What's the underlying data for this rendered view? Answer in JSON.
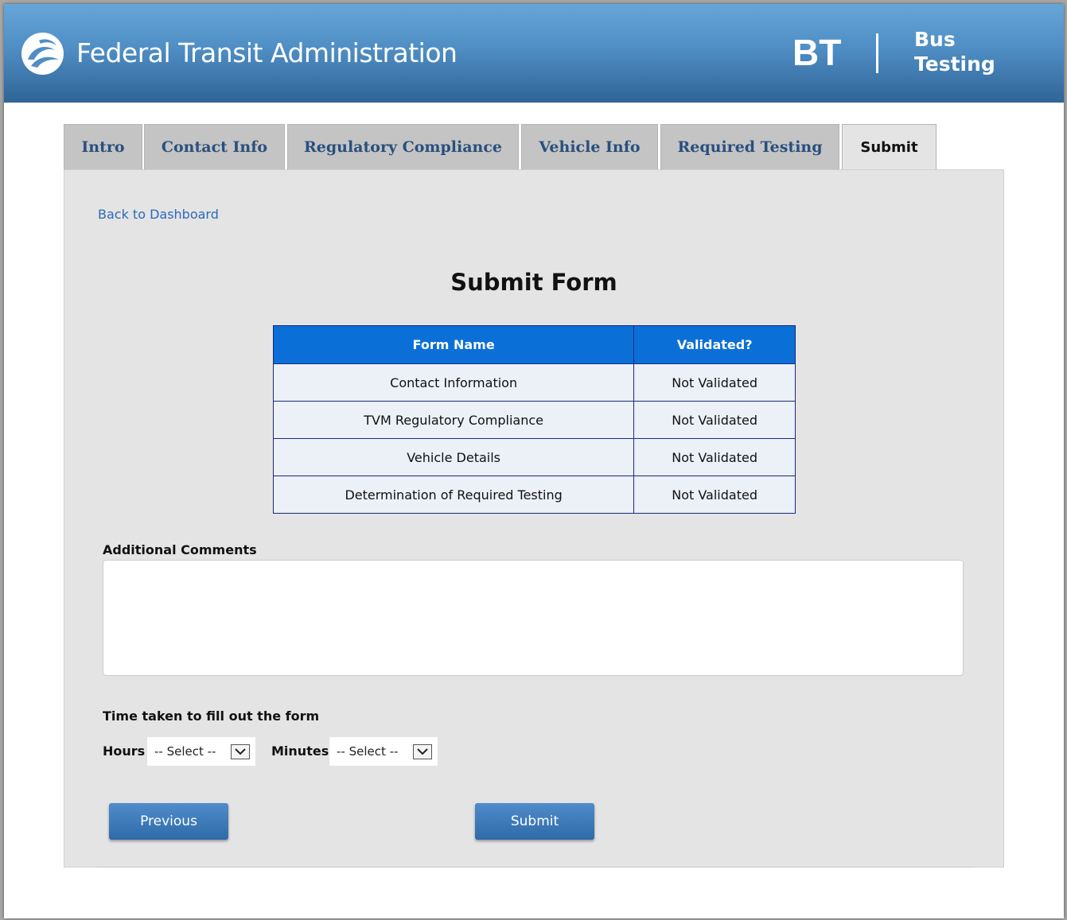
{
  "header": {
    "agency_name": "Federal Transit Administration",
    "app_abbr": "BT",
    "app_name_line1": "Bus",
    "app_name_line2": "Testing"
  },
  "tabs": [
    {
      "label": "Intro",
      "active": false
    },
    {
      "label": "Contact Info",
      "active": false
    },
    {
      "label": "Regulatory Compliance",
      "active": false
    },
    {
      "label": "Vehicle Info",
      "active": false
    },
    {
      "label": "Required Testing",
      "active": false
    },
    {
      "label": "Submit",
      "active": true
    }
  ],
  "main": {
    "back_link": "Back to Dashboard",
    "title": "Submit Form",
    "table": {
      "headers": [
        "Form Name",
        "Validated?"
      ],
      "rows": [
        [
          "Contact Information",
          "Not Validated"
        ],
        [
          "TVM Regulatory Compliance",
          "Not Validated"
        ],
        [
          "Vehicle Details",
          "Not Validated"
        ],
        [
          "Determination of Required Testing",
          "Not Validated"
        ]
      ]
    },
    "comments_label": "Additional Comments",
    "comments_value": "",
    "time_label": "Time taken to fill out the form",
    "hours_label": "Hours",
    "hours_value": "-- Select --",
    "minutes_label": "Minutes",
    "minutes_value": "-- Select --",
    "previous_button": "Previous",
    "submit_button": "Submit"
  },
  "colors": {
    "header_gradient_top": "#66a6d8",
    "header_gradient_bottom": "#2f6497",
    "table_header": "#0b6fd8",
    "link": "#2a6ab8",
    "button": "#3a78b8"
  }
}
